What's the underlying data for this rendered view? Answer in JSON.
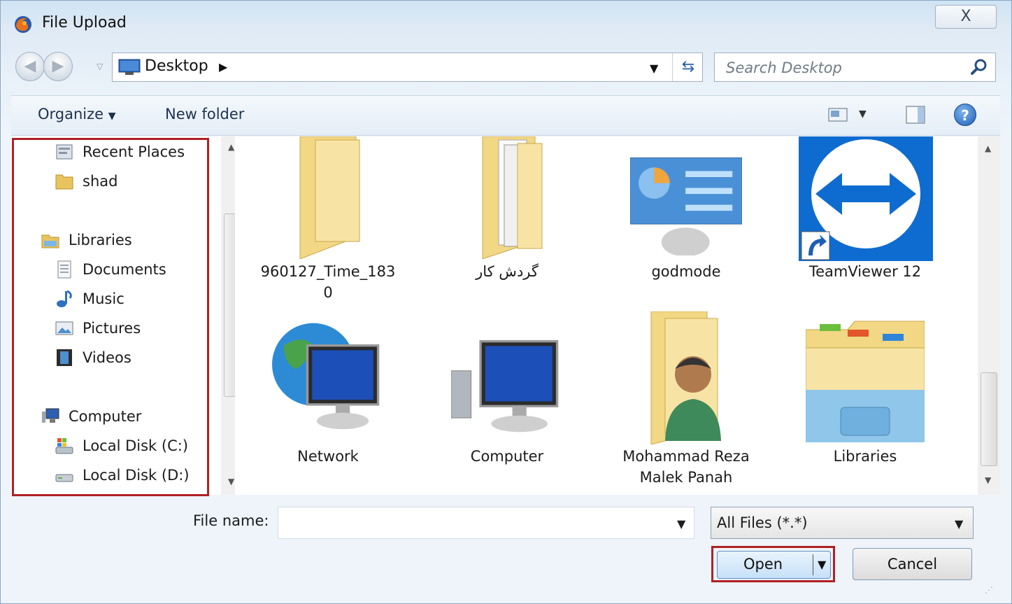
{
  "window": {
    "title": "File Upload",
    "close_label": "X"
  },
  "address": {
    "location": "Desktop"
  },
  "search": {
    "placeholder": "Search Desktop"
  },
  "toolbar": {
    "organize_label": "Organize",
    "new_folder_label": "New folder",
    "help_label": "?"
  },
  "navigation": {
    "items": [
      {
        "label": "Recent Places",
        "icon": "recent-places-icon"
      },
      {
        "label": "shad",
        "icon": "folder-icon"
      },
      {
        "label": "Libraries",
        "icon": "libraries-icon"
      },
      {
        "label": "Documents",
        "icon": "documents-icon"
      },
      {
        "label": "Music",
        "icon": "music-icon"
      },
      {
        "label": "Pictures",
        "icon": "pictures-icon"
      },
      {
        "label": "Videos",
        "icon": "videos-icon"
      },
      {
        "label": "Computer",
        "icon": "computer-icon"
      },
      {
        "label": "Local Disk (C:)",
        "icon": "local-disk-c-icon"
      },
      {
        "label": "Local Disk (D:)",
        "icon": "local-disk-d-icon"
      }
    ]
  },
  "files": [
    {
      "line1": "960127_Time_183",
      "line2": "0",
      "icon": "folder-icon"
    },
    {
      "line1": "گردش کار",
      "line2": "",
      "icon": "folder-documents-icon"
    },
    {
      "line1": "godmode",
      "line2": "",
      "icon": "control-panel-icon"
    },
    {
      "line1": "TeamViewer 12",
      "line2": "",
      "icon": "teamviewer-shortcut-icon"
    },
    {
      "line1": "Network",
      "line2": "",
      "icon": "network-icon"
    },
    {
      "line1": "Computer",
      "line2": "",
      "icon": "computer-icon"
    },
    {
      "line1": "Mohammad Reza",
      "line2": "Malek Panah",
      "icon": "user-folder-icon"
    },
    {
      "line1": "Libraries",
      "line2": "",
      "icon": "libraries-icon"
    }
  ],
  "footer": {
    "file_name_label": "File name:",
    "file_name_value": "",
    "file_type": "All Files (*.*)",
    "open_label": "Open",
    "cancel_label": "Cancel"
  },
  "colors": {
    "highlight_box": "#b02025",
    "accent": "#1e5fb5"
  }
}
